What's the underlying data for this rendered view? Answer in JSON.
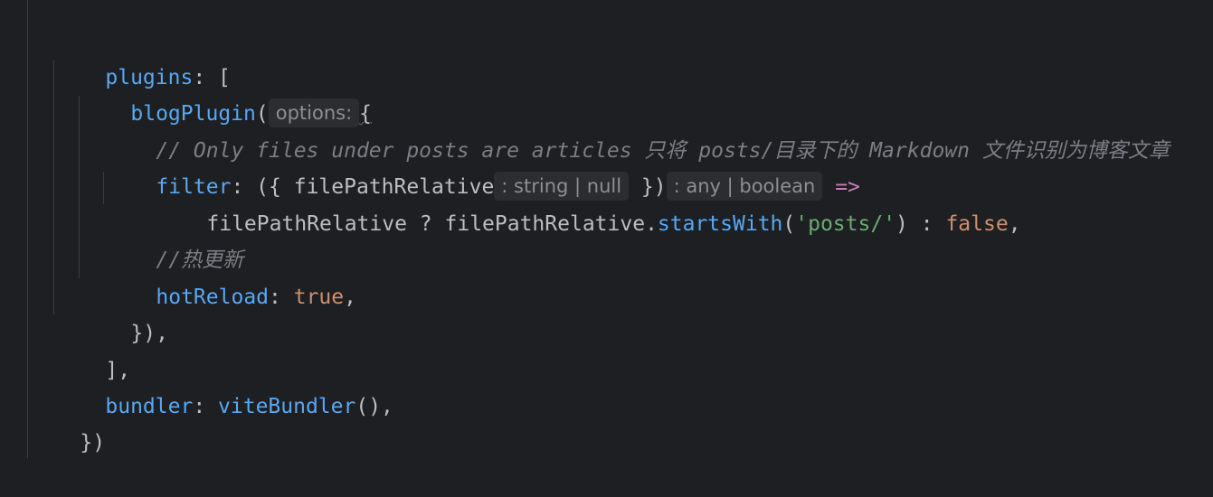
{
  "colors": {
    "background": "#1e1f22",
    "property": "#56a8f5",
    "string": "#6aab73",
    "comment": "#7a7e85",
    "keyword": "#cf8e6d",
    "text": "#bcbec4",
    "hint_bg": "#2b2d30",
    "hint_text": "#8c8f94"
  },
  "code": {
    "l1": {
      "prop": "plugins",
      "rest": ": ["
    },
    "l2": {
      "func": "blogPlugin",
      "open": "(",
      "hint": "options:",
      "brace": "{"
    },
    "l3": {
      "comment": "// Only files under posts are articles 只将 posts/目录下的 Markdown 文件识别为博客文章"
    },
    "l4": {
      "prop": "filter",
      "p1": ": ({ ",
      "param": "filePathRelative",
      "hint1": ": string | null",
      "p2": " })",
      "hint2": ": any | boolean",
      "arrow": " =>"
    },
    "l5": {
      "a": "filePathRelative",
      "b": " ? ",
      "c": "filePathRelative",
      "d": ".",
      "method": "startsWith",
      "e": "(",
      "str": "'posts/'",
      "f": ") : ",
      "bool": "false",
      "g": ","
    },
    "l6": {
      "comment": "//热更新"
    },
    "l7": {
      "prop": "hotReload",
      "p1": ": ",
      "bool": "true",
      "p2": ","
    },
    "l8": {
      "text": "}),"
    },
    "l9": {
      "text": "],"
    },
    "l10": {
      "prop": "bundler",
      "p1": ": ",
      "func": "viteBundler",
      "p2": "(),"
    },
    "l11": {
      "text": "})"
    }
  }
}
